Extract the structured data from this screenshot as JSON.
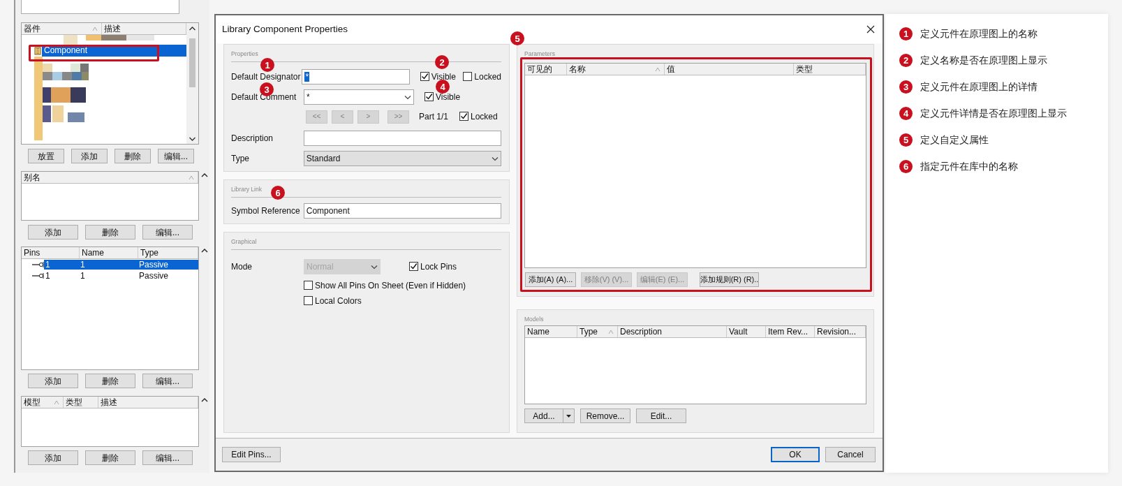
{
  "left_panel": {
    "components": {
      "columns": [
        {
          "label": "器件",
          "sorted": true
        },
        {
          "label": "描述",
          "sorted": false
        }
      ],
      "items": [
        {
          "label": "Component",
          "selected": true
        }
      ],
      "buttons": [
        "放置",
        "添加",
        "删除",
        "编辑..."
      ]
    },
    "aliases": {
      "columns": [
        {
          "label": "别名",
          "sorted": true
        }
      ],
      "buttons": [
        "添加",
        "删除",
        "编辑..."
      ]
    },
    "pins": {
      "columns": [
        {
          "label": "Pins",
          "sorted": false
        },
        {
          "label": "Name",
          "sorted": false
        },
        {
          "label": "Type",
          "sorted": false
        }
      ],
      "rows": [
        {
          "cells": [
            "1",
            "1",
            "Passive"
          ],
          "selected": true
        },
        {
          "cells": [
            "1",
            "1",
            "Passive"
          ],
          "selected": false
        }
      ],
      "buttons": [
        "添加",
        "删除",
        "编辑..."
      ]
    },
    "models": {
      "columns": [
        {
          "label": "模型",
          "sorted": true
        },
        {
          "label": "类型",
          "sorted": false
        },
        {
          "label": "描述",
          "sorted": false
        }
      ],
      "buttons": [
        "添加",
        "删除",
        "编辑..."
      ]
    }
  },
  "dialog": {
    "title": "Library Component Properties",
    "properties": {
      "title": "Properties",
      "designator_label": "Default Designator",
      "designator_value": "*",
      "designator_value_selected": true,
      "designator_visible": {
        "label": "Visible",
        "checked": true
      },
      "designator_locked": {
        "label": "Locked",
        "checked": false
      },
      "comment_label": "Default Comment",
      "comment_value": "*",
      "comment_visible": {
        "label": "Visible",
        "checked": true
      },
      "part_buttons": [
        {
          "label": "<<",
          "disabled": true
        },
        {
          "label": "<",
          "disabled": true
        },
        {
          "label": ">",
          "disabled": true
        },
        {
          "label": ">>",
          "disabled": true
        }
      ],
      "part": "Part 1/1",
      "part_locked": {
        "label": "Locked",
        "checked": true
      },
      "description_label": "Description",
      "type_label": "Type",
      "type_value": "Standard"
    },
    "library_link": {
      "title": "Library Link",
      "symbol_label": "Symbol Reference",
      "symbol_value": "Component"
    },
    "graphical": {
      "title": "Graphical",
      "mode_label": "Mode",
      "mode_value": "Normal",
      "mode_disabled": true,
      "checkboxes": [
        {
          "label": "Lock Pins",
          "checked": true
        },
        {
          "label": "Show All Pins On Sheet (Even if Hidden)",
          "checked": false
        },
        {
          "label": "Local Colors",
          "checked": false
        }
      ]
    },
    "parameters": {
      "title": "Parameters",
      "columns": [
        {
          "label": "可见的",
          "sorted": false
        },
        {
          "label": "名称",
          "sorted": true
        },
        {
          "label": "值",
          "sorted": false
        },
        {
          "label": "类型",
          "sorted": false
        }
      ],
      "buttons": [
        {
          "label": "添加(A) (A)...",
          "disabled": false
        },
        {
          "label": "移除(V) (V)...",
          "disabled": true
        },
        {
          "label": "编辑(E) (E)...",
          "disabled": true
        },
        {
          "label": "添加规则(R) (R)..",
          "disabled": false
        }
      ]
    },
    "models": {
      "title": "Models",
      "columns": [
        {
          "label": "Name",
          "sorted": false
        },
        {
          "label": "Type",
          "sorted": true
        },
        {
          "label": "Description",
          "sorted": false
        },
        {
          "label": "Vault",
          "sorted": false
        },
        {
          "label": "Item Rev...",
          "sorted": false
        },
        {
          "label": "Revision...",
          "sorted": false
        }
      ],
      "buttons": [
        {
          "label": "Add...",
          "kind": "split"
        },
        {
          "label": "Remove...",
          "kind": "plain"
        },
        {
          "label": "Edit...",
          "kind": "plain"
        }
      ]
    },
    "footer_buttons": [
      {
        "label": "Edit Pins...",
        "kind": "plain"
      },
      {
        "label": "OK",
        "kind": "default"
      },
      {
        "label": "Cancel",
        "kind": "plain"
      }
    ]
  },
  "annotations": [
    {
      "number": "1"
    },
    {
      "number": "2"
    },
    {
      "number": "3"
    },
    {
      "number": "4"
    },
    {
      "number": "5"
    },
    {
      "number": "6"
    }
  ],
  "legend": [
    {
      "number": "1",
      "text": "定义元件在原理图上的名称"
    },
    {
      "number": "2",
      "text": "定义名称是否在原理图上显示"
    },
    {
      "number": "3",
      "text": "定义元件在原理图上的详情"
    },
    {
      "number": "4",
      "text": "定义元件详情是否在原理图上显示"
    },
    {
      "number": "5",
      "text": "定义自定义属性"
    },
    {
      "number": "6",
      "text": "指定元件在库中的名称"
    }
  ]
}
